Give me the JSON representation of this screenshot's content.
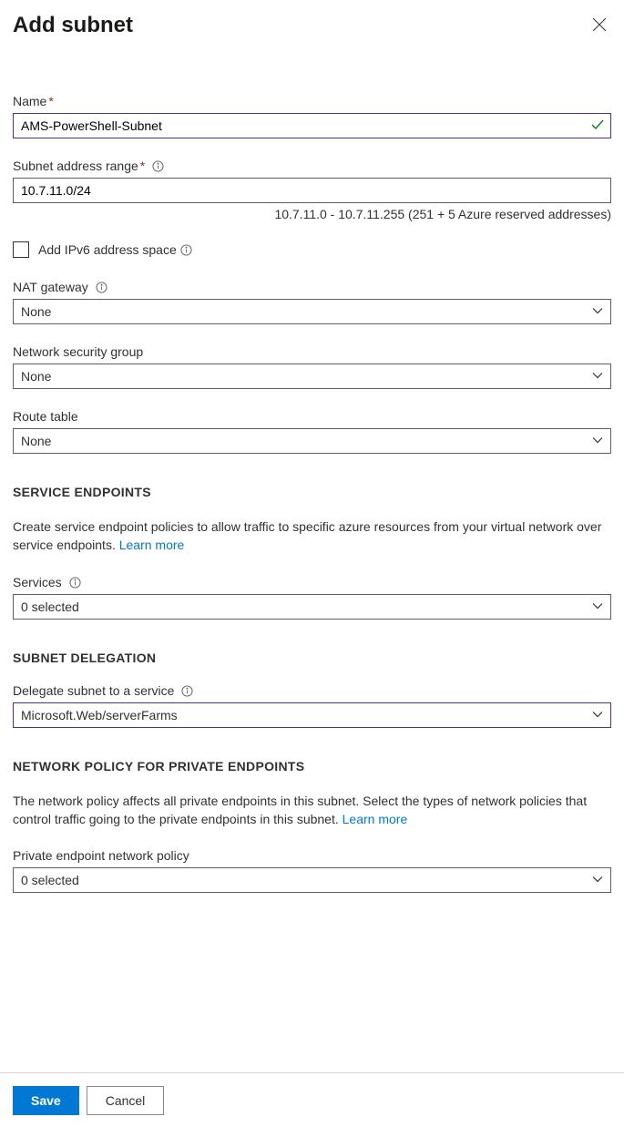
{
  "header": {
    "title": "Add subnet"
  },
  "fields": {
    "name": {
      "label": "Name",
      "value": "AMS-PowerShell-Subnet"
    },
    "subnet_range": {
      "label": "Subnet address range",
      "value": "10.7.11.0/24",
      "hint": "10.7.11.0 - 10.7.11.255 (251 + 5 Azure reserved addresses)"
    },
    "ipv6": {
      "label": "Add IPv6 address space"
    },
    "nat_gateway": {
      "label": "NAT gateway",
      "value": "None"
    },
    "nsg": {
      "label": "Network security group",
      "value": "None"
    },
    "route_table": {
      "label": "Route table",
      "value": "None"
    }
  },
  "service_endpoints": {
    "heading": "SERVICE ENDPOINTS",
    "description": "Create service endpoint policies to allow traffic to specific azure resources from your virtual network over service endpoints. ",
    "learn_more": "Learn more",
    "services_label": "Services",
    "services_value": "0 selected"
  },
  "subnet_delegation": {
    "heading": "SUBNET DELEGATION",
    "label": "Delegate subnet to a service",
    "value": "Microsoft.Web/serverFarms"
  },
  "network_policy": {
    "heading": "NETWORK POLICY FOR PRIVATE ENDPOINTS",
    "description": "The network policy affects all private endpoints in this subnet. Select the types of network policies that control traffic going to the private endpoints in this subnet. ",
    "learn_more": "Learn more",
    "label": "Private endpoint network policy",
    "value": "0 selected"
  },
  "footer": {
    "save": "Save",
    "cancel": "Cancel"
  }
}
